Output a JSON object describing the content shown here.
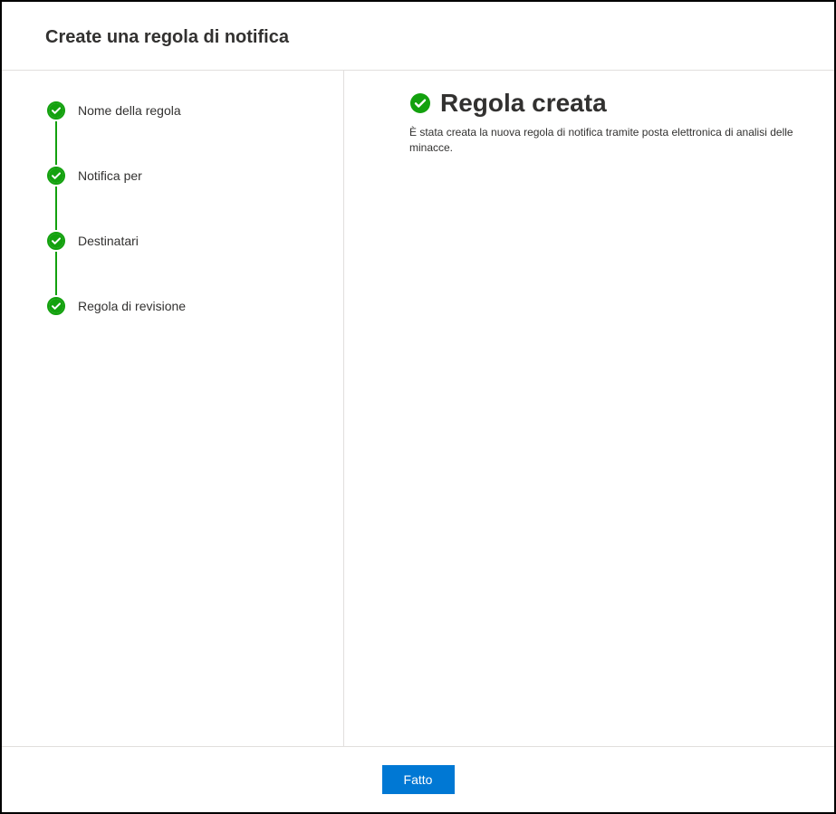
{
  "header": {
    "title": "Create una regola di notifica"
  },
  "sidebar": {
    "steps": [
      {
        "label": "Nome della regola"
      },
      {
        "label": "Notifica per"
      },
      {
        "label": "Destinatari"
      },
      {
        "label": "Regola di revisione"
      }
    ]
  },
  "main": {
    "result_title": "Regola creata",
    "result_description": "È stata creata la nuova regola di notifica tramite posta elettronica di analisi delle minacce."
  },
  "footer": {
    "done_label": "Fatto"
  },
  "colors": {
    "success_green": "#13a10e",
    "primary_blue": "#0078d4"
  }
}
